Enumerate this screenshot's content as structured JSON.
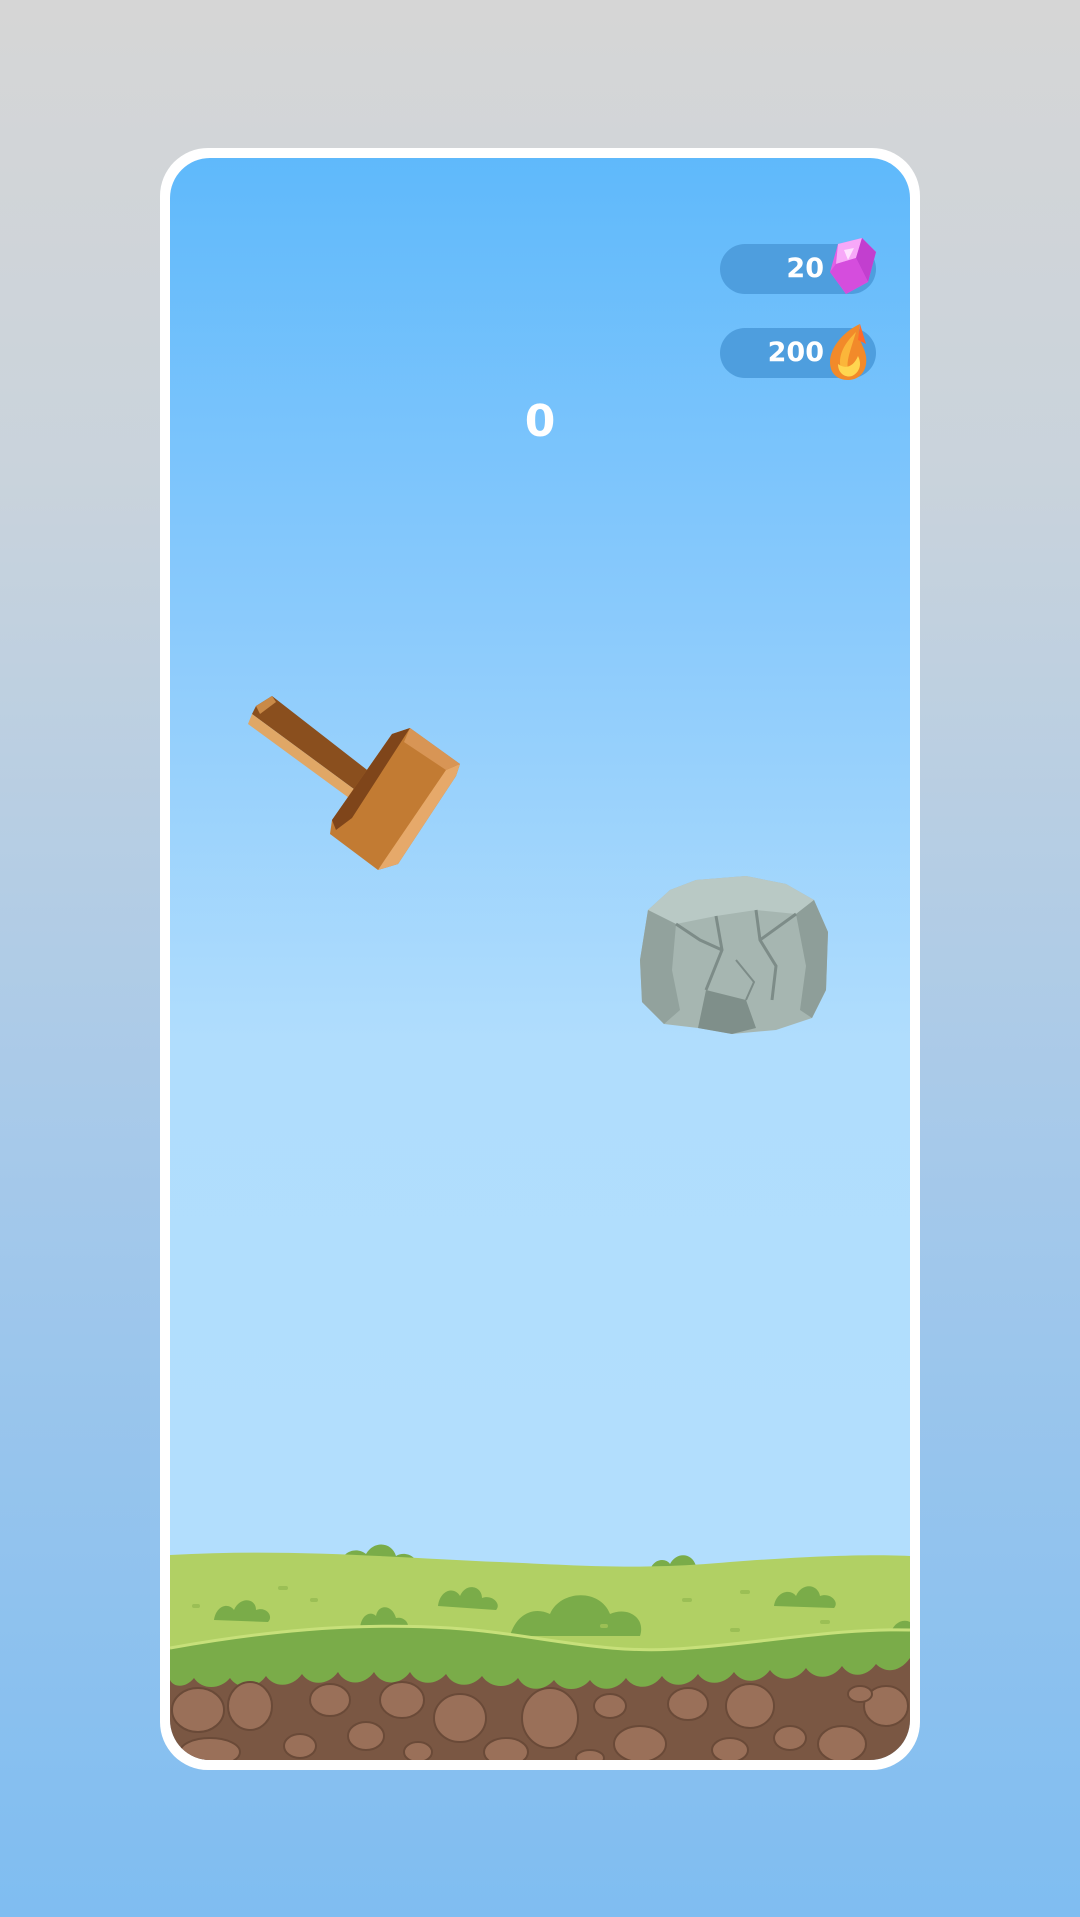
{
  "hud": {
    "gems": {
      "value": "20",
      "icon": "pink-gem-icon",
      "color": "#e25fe6"
    },
    "fire_crystals": {
      "value": "200",
      "icon": "fire-crystal-icon",
      "color": "#f7a23a"
    }
  },
  "score": "0",
  "scene": {
    "hammer": "wooden-hammer",
    "rock": "grey-boulder",
    "ground": "grass-and-dirt"
  },
  "colors": {
    "sky_top": "#5fb9fb",
    "sky_bottom": "#b3dffd",
    "grass": "#b1d064",
    "grass_dark": "#7aac49",
    "dirt": "#7a5743",
    "stone": "#a6b6b1"
  }
}
